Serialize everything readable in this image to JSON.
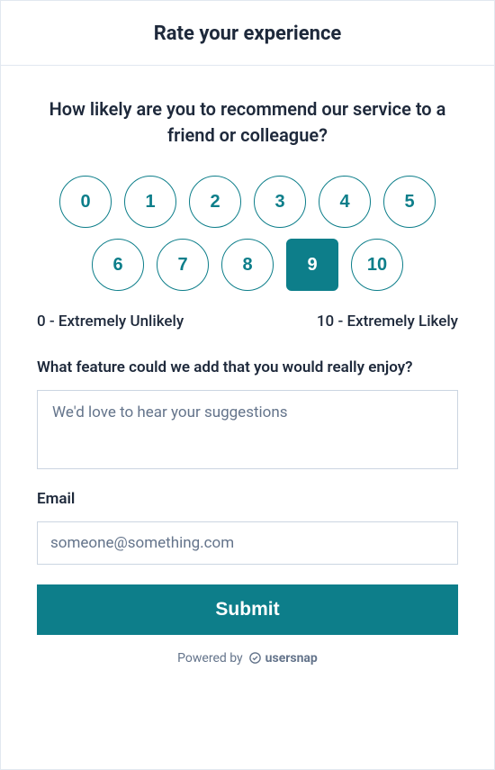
{
  "header": {
    "title": "Rate your experience"
  },
  "nps": {
    "question": "How likely are you to recommend our service to a friend or colleague?",
    "options_row1": [
      "0",
      "1",
      "2",
      "3",
      "4",
      "5"
    ],
    "options_row2": [
      "6",
      "7",
      "8",
      "9",
      "10"
    ],
    "selected": "9",
    "low_label": "0 - Extremely Unlikely",
    "high_label": "10 - Extremely Likely"
  },
  "feature": {
    "label": "What feature could we add that you would really enjoy?",
    "placeholder": "We'd love to hear your suggestions",
    "value": ""
  },
  "email": {
    "label": "Email",
    "placeholder": "someone@something.com",
    "value": ""
  },
  "submit": {
    "label": "Submit"
  },
  "footer": {
    "powered_by": "Powered by",
    "brand": "usersnap"
  },
  "colors": {
    "accent": "#0d7e8a"
  }
}
